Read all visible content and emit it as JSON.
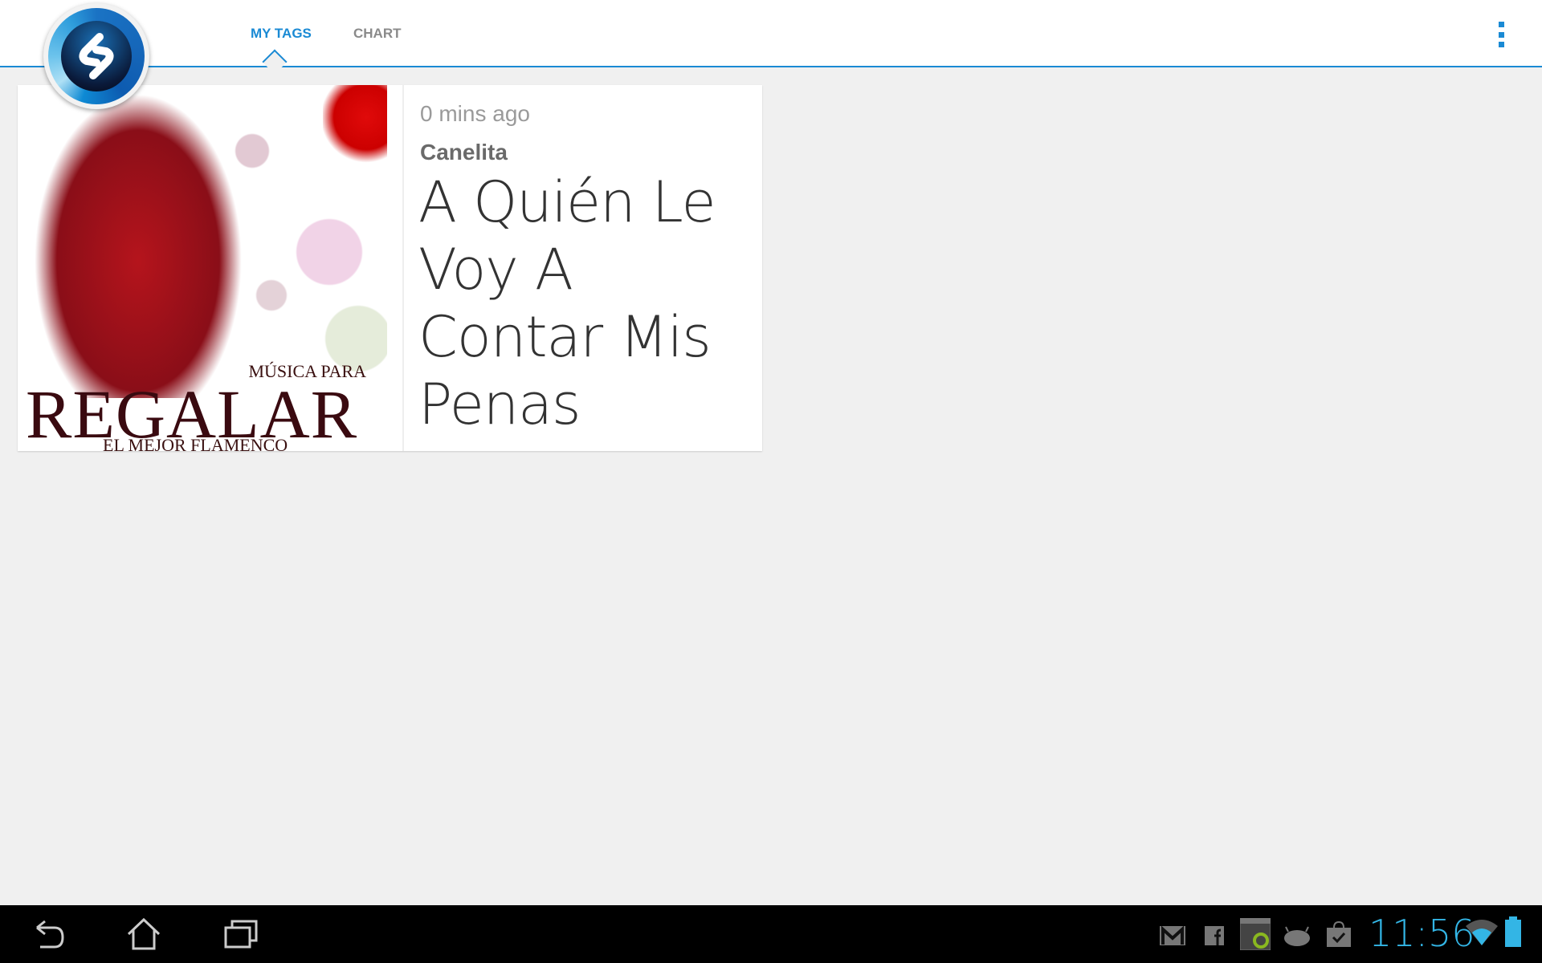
{
  "header": {
    "tabs": [
      {
        "label": "MY TAGS",
        "active": true
      },
      {
        "label": "CHART",
        "active": false
      }
    ],
    "logo": "shazam-logo-icon",
    "menu_icon": "overflow-menu-icon",
    "accent": "#1a8ad4"
  },
  "tag": {
    "time": "0 mins ago",
    "artist": "Canelita",
    "title": "A Quién Le Voy A Contar Mis Penas",
    "album_art": {
      "line1": "MÚSICA PARA",
      "line2": "REGALAR",
      "line3": "EL MEJOR FLAMENCO"
    }
  },
  "navbar": {
    "buttons": [
      "back-icon",
      "home-icon",
      "recent-apps-icon"
    ],
    "notifications": [
      "gmail-icon",
      "facebook-icon",
      "sync-app-icon",
      "android-icon",
      "play-store-icon"
    ],
    "clock": "11:56",
    "clock_color": "#33b5e5",
    "wifi": "wifi-icon",
    "battery": "battery-icon"
  }
}
